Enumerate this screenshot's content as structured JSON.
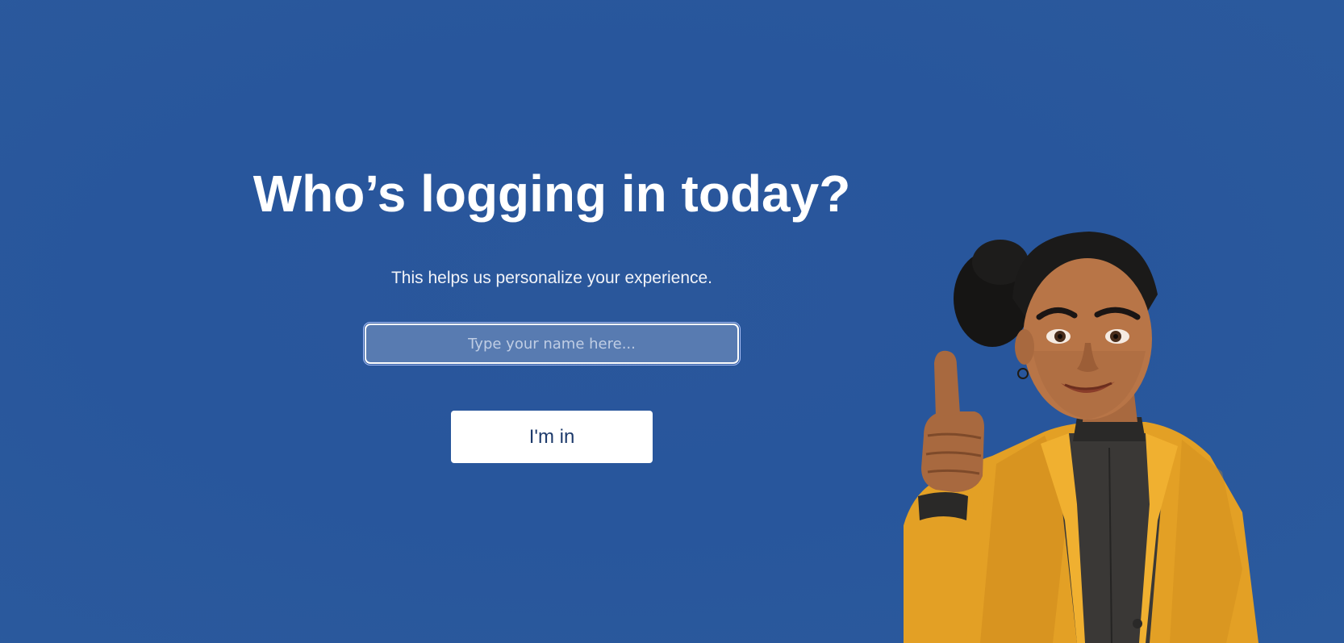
{
  "login": {
    "title": "Who’s logging in today?",
    "subtitle": "This helps us personalize your experience.",
    "name_input": {
      "placeholder": "Type your name here...",
      "value": ""
    },
    "submit_label": "I'm in"
  },
  "illustration": {
    "icon": "woman-thumbs-up-illustration"
  },
  "colors": {
    "background": "#28569c",
    "button_text": "#1d3a6b",
    "jacket": "#e3a025"
  }
}
